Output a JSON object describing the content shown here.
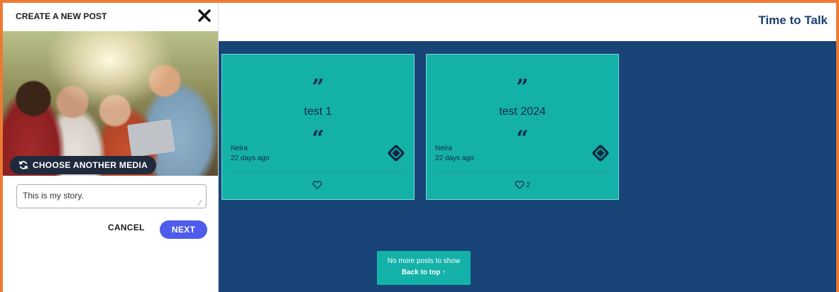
{
  "panel": {
    "title": "CREATE A NEW POST",
    "choose_media_label": "CHOOSE ANOTHER MEDIA",
    "story_value": "This is my story.",
    "cancel_label": "CANCEL",
    "next_label": "NEXT"
  },
  "header": {
    "app_name": "Time to Talk"
  },
  "posts": [
    {
      "text": "test 1",
      "author": "Neira",
      "time": "22 days ago",
      "likes": ""
    },
    {
      "text": "test 2024",
      "author": "Neira",
      "time": "22 days ago",
      "likes": "2"
    }
  ],
  "footer_notice": {
    "message": "No more posts to show",
    "back_to_top": "Back to top ↑"
  },
  "colors": {
    "frame": "#ec7a33",
    "background": "#184477",
    "card": "#14b1a9",
    "next_button": "#4f5bea",
    "brand": "#1b3f73"
  },
  "icons": [
    "close-icon",
    "refresh-icon",
    "resize-handle-icon",
    "close-quote-icon",
    "open-quote-icon",
    "diamond-badge-icon",
    "heart-icon",
    "arrow-up-icon"
  ]
}
